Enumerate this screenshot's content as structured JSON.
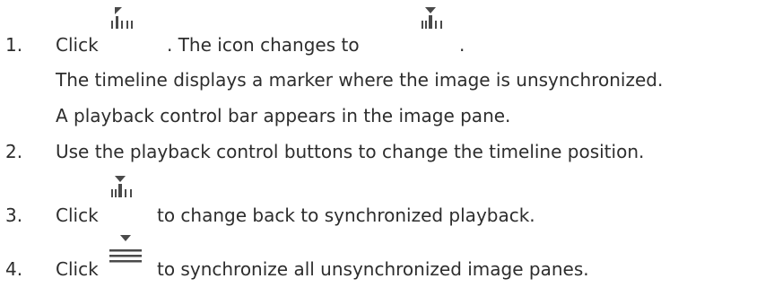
{
  "steps": [
    {
      "number": "1.",
      "parts": [
        "Click",
        ". The icon changes to",
        "."
      ],
      "icon_before": "unsync-timeline-icon",
      "icon_after": "sync-timeline-icon",
      "details": [
        "The timeline displays a marker where the image is unsynchronized.",
        "A playback control bar appears in the image pane."
      ]
    },
    {
      "number": "2.",
      "text": "Use the playback control buttons to change the timeline position."
    },
    {
      "number": "3.",
      "parts": [
        "Click",
        "to change back to synchronized playback."
      ],
      "icon": "sync-timeline-icon"
    },
    {
      "number": "4.",
      "parts": [
        "Click",
        "to synchronize all unsynchronized image panes."
      ],
      "icon": "sync-all-icon"
    }
  ],
  "colors": {
    "text": "#2d2d2d",
    "icon": "#4a4a4a"
  }
}
